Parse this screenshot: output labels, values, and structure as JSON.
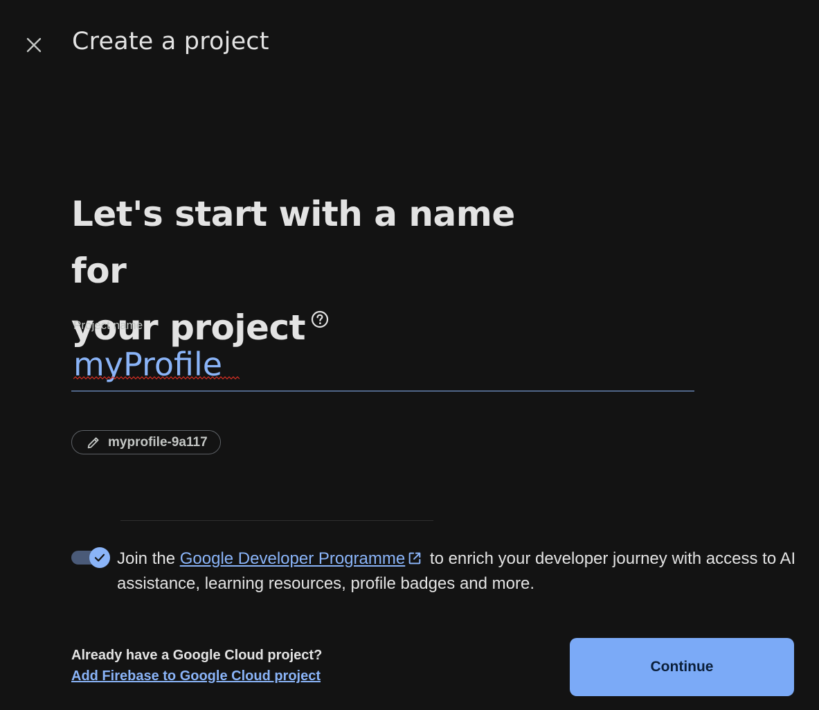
{
  "header": {
    "title": "Create a project"
  },
  "main": {
    "heading_line1": "Let's start with a name for",
    "heading_line2": "your project",
    "project_name": {
      "label": "Project name",
      "value": "myProfile"
    },
    "project_id": "myprofile-9a117"
  },
  "gdp": {
    "toggle_on": true,
    "text_before": "Join the ",
    "link_text": "Google Developer Programme",
    "text_after": " to enrich your developer journey with access to AI assistance, learning resources, profile badges and more."
  },
  "footer": {
    "already_text": "Already have a Google Cloud project?",
    "add_firebase_link": "Add Firebase to Google Cloud project",
    "continue_label": "Continue"
  },
  "colors": {
    "background": "#131313",
    "accent": "#8ab4f8",
    "button": "#7baaf7"
  },
  "icons": {
    "close": "close-icon",
    "help": "help-icon",
    "edit": "pencil-icon",
    "external": "external-link-icon",
    "check": "check-icon"
  }
}
